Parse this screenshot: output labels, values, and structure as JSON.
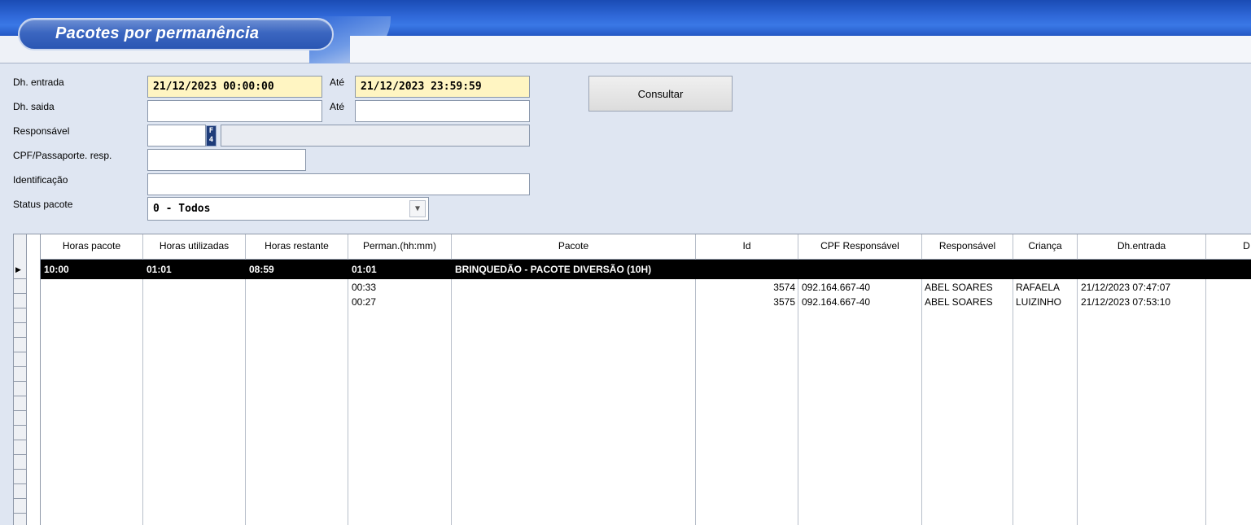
{
  "window": {
    "title": "Pacotes por permanência"
  },
  "form": {
    "dh_entrada_label": "Dh. entrada",
    "dh_entrada_from": "21/12/2023 00:00:00",
    "ate_label": "Até",
    "dh_entrada_to": "21/12/2023 23:59:59",
    "dh_saida_label": "Dh. saida",
    "dh_saida_from": "",
    "dh_saida_to": "",
    "responsavel_label": "Responsável",
    "responsavel_code": "",
    "responsavel_lookup_key": "F4",
    "responsavel_name": "",
    "cpf_label": "CPF/Passaporte. resp.",
    "cpf_value": "",
    "identificacao_label": "Identificação",
    "identificacao_value": "",
    "status_label": "Status pacote",
    "status_value": "0 - Todos",
    "consultar_label": "Consultar"
  },
  "grid": {
    "columns": [
      "Horas pacote",
      "Horas utilizadas",
      "Horas restante",
      "Perman.(hh:mm)",
      "Pacote",
      "Id",
      "CPF Responsável",
      "Responsável",
      "Criança",
      "Dh.entrada",
      "D"
    ],
    "group_row": {
      "horas_pacote": "10:00",
      "horas_utilizadas": "01:01",
      "horas_restante": "08:59",
      "perman": "01:01",
      "pacote": "BRINQUEDÃO - PACOTE DIVERSÃO (10H)",
      "expand_symbol": "-"
    },
    "rows": [
      {
        "perman": "00:33",
        "id": "3574",
        "cpf": "092.164.667-40",
        "responsavel": "ABEL SOARES",
        "crianca": "RAFAELA",
        "dh_entrada": "21/12/2023 07:47:07"
      },
      {
        "perman": "00:27",
        "id": "3575",
        "cpf": "092.164.667-40",
        "responsavel": "ABEL SOARES",
        "crianca": "LUIZINHO",
        "dh_entrada": "21/12/2023 07:53:10"
      }
    ]
  }
}
